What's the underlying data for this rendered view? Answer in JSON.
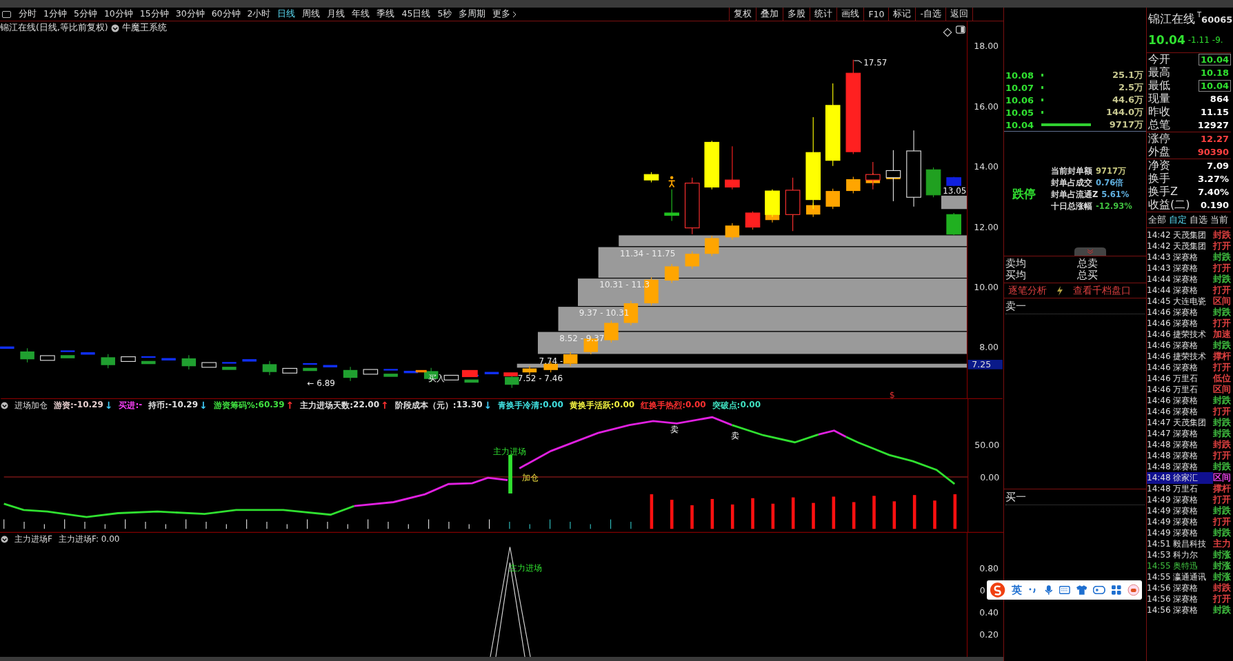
{
  "toolbar": {
    "periods": [
      {
        "label": "分时",
        "selected": false
      },
      {
        "label": "1分钟",
        "selected": false
      },
      {
        "label": "5分钟",
        "selected": false
      },
      {
        "label": "10分钟",
        "selected": false
      },
      {
        "label": "15分钟",
        "selected": false
      },
      {
        "label": "30分钟",
        "selected": false
      },
      {
        "label": "60分钟",
        "selected": false
      },
      {
        "label": "2小时",
        "selected": false
      },
      {
        "label": "日线",
        "selected": true
      },
      {
        "label": "周线",
        "selected": false
      },
      {
        "label": "月线",
        "selected": false
      },
      {
        "label": "年线",
        "selected": false
      },
      {
        "label": "季线",
        "selected": false
      },
      {
        "label": "45日线",
        "selected": false
      },
      {
        "label": "5秒",
        "selected": false
      },
      {
        "label": "多周期",
        "selected": false
      }
    ],
    "more": "更多",
    "buttons": [
      "复权",
      "叠加",
      "多股",
      "统计",
      "画线",
      "F10",
      "标记",
      "-自选",
      "返回"
    ]
  },
  "chart": {
    "title": "锦江在线(日线,等比前复权)",
    "system": "牛魔王系统",
    "price_axis": [
      "18.00",
      "16.00",
      "14.00",
      "12.00",
      "10.00",
      "8.00"
    ],
    "current_price_tag": "7.25",
    "high_label": "17.57",
    "last_label": "13.05",
    "low_label": "6.89",
    "low_arrow": "←",
    "buy_label": "买入",
    "zones": [
      "11.34 - 11.75",
      "10.31 - 11.3",
      "9.37 - 10.31",
      "8.52 - 9.37",
      "7.74 -",
      "7.52 - 7.46"
    ],
    "marker": "$"
  },
  "indicator_1": {
    "name": "进场加仓",
    "legend": [
      {
        "label": "游资:",
        "value": "-10.29",
        "arrow": {
          "text": "↓",
          "color": "#40d0ff"
        },
        "color": "#e8d0d0"
      },
      {
        "label": "买进:",
        "value": "-",
        "color": "#ff40ff"
      },
      {
        "label": "持币:",
        "value": "-10.29",
        "arrow": {
          "text": "↓",
          "color": "#40d0ff"
        },
        "color": "#e0e0e0"
      },
      {
        "label": "游资筹码%:",
        "value": "60.39",
        "arrow": {
          "text": "↑",
          "color": "#ff3030"
        },
        "color": "#40e040"
      },
      {
        "label": "主力进场天数:",
        "value": "22.00",
        "arrow": {
          "text": "↑",
          "color": "#ff3030"
        },
        "color": "#e0e0e0"
      },
      {
        "label": "阶段成本（元）:",
        "value": "13.30",
        "arrow": {
          "text": "↓",
          "color": "#40d0ff"
        },
        "color": "#e0e0e0"
      },
      {
        "label": "青换手冷清:",
        "value": "0.00",
        "color": "#40e0e0"
      },
      {
        "label": "黄换手活跃:",
        "value": "0.00",
        "color": "#f0f040"
      },
      {
        "label": "红换手热烈:",
        "value": "0.00",
        "color": "#ff3030"
      },
      {
        "label": "突破点:",
        "value": "0.00",
        "color": "#40e0c0"
      }
    ],
    "axis": [
      "50.00",
      "0.00"
    ],
    "labels": [
      {
        "text": "主力进场",
        "kind": "entry"
      },
      {
        "text": "加仓",
        "kind": "add"
      },
      {
        "text": "卖",
        "kind": "sell"
      },
      {
        "text": "卖",
        "kind": "sell"
      }
    ]
  },
  "indicator_2": {
    "name": "主力进场F",
    "legend": "主力进场F: 0.00",
    "axis": [
      "0.80",
      "0",
      "0.40",
      "0.20"
    ],
    "label": "主力进场"
  },
  "order_book": [
    {
      "price": "10.08",
      "volume": "25.1万",
      "kind": "dot"
    },
    {
      "price": "10.07",
      "volume": "2.5万",
      "kind": "dot"
    },
    {
      "price": "10.06",
      "volume": "44.6万",
      "kind": "dot"
    },
    {
      "price": "10.05",
      "volume": "144.0万",
      "kind": "dot"
    },
    {
      "price": "10.04",
      "volume": "9717万",
      "kind": "bar"
    }
  ],
  "limit_status": "跌停",
  "seal_info": [
    {
      "label": "当前封单额",
      "value": "9717万",
      "color": "#c8c880"
    },
    {
      "label": "封单占成交",
      "value": "0.76倍",
      "color": "#60b0e0"
    },
    {
      "label": "封单占流通Z",
      "value": "5.61%",
      "color": "#60b0e0"
    },
    {
      "label": "十日总涨幅",
      "value": "-12.93%",
      "color": "#40c040"
    }
  ],
  "totals": [
    {
      "left": "卖均",
      "right": "总卖"
    },
    {
      "left": "买均",
      "right": "总买"
    }
  ],
  "analysis_links": [
    "逐笔分析",
    "查看千档盘口"
  ],
  "sell_one": "卖一",
  "buy_one": "买一",
  "stock": {
    "name": "锦江在线",
    "mark": "T",
    "code": "60065",
    "price": "10.04",
    "change": "-1.11",
    "change_pct": "-9."
  },
  "quotes": [
    {
      "label": "今开",
      "value": "10.04",
      "color": "#30e030",
      "boxed": true
    },
    {
      "label": "最高",
      "value": "10.18",
      "color": "#30e030",
      "boxed": false
    },
    {
      "label": "最低",
      "value": "10.04",
      "color": "#30e030",
      "boxed": true
    },
    {
      "label": "现量",
      "value": "864",
      "color": "#ffffff",
      "boxed": false
    },
    {
      "label": "昨收",
      "value": "11.15",
      "color": "#ffffff",
      "boxed": false
    },
    {
      "label": "总笔",
      "value": "12927",
      "color": "#ffffff",
      "boxed": false
    },
    {
      "label": "涨停",
      "value": "12.27",
      "color": "#ff4040",
      "boxed": false
    },
    {
      "label": "外盘",
      "value": "90390",
      "color": "#ff4040",
      "boxed": false
    },
    {
      "label": "净资",
      "value": "7.09",
      "color": "#ffffff",
      "boxed": false
    },
    {
      "label": "换手",
      "value": "3.27%",
      "color": "#ffffff",
      "boxed": false
    },
    {
      "label": "换手Z",
      "value": "7.40%",
      "color": "#ffffff",
      "boxed": false
    },
    {
      "label": "收益(二)",
      "value": "0.190",
      "color": "#ffffff",
      "boxed": false
    }
  ],
  "list_tabs": [
    {
      "label": "全部",
      "selected": false
    },
    {
      "label": "自定",
      "selected": true
    },
    {
      "label": "自选",
      "selected": false
    },
    {
      "label": "当前",
      "selected": false
    }
  ],
  "alerts": [
    {
      "time": "14:42",
      "name": "天茂集团",
      "signal": "封跌",
      "color": "#e04040",
      "selected": false,
      "highlighted": false
    },
    {
      "time": "14:42",
      "name": "天茂集团",
      "signal": "打开",
      "color": "#e04040",
      "selected": false,
      "highlighted": false
    },
    {
      "time": "14:43",
      "name": "深赛格",
      "signal": "封跌",
      "color": "#40c040",
      "selected": false,
      "highlighted": false
    },
    {
      "time": "14:43",
      "name": "深赛格",
      "signal": "打开",
      "color": "#e04040",
      "selected": false,
      "highlighted": false
    },
    {
      "time": "14:44",
      "name": "深赛格",
      "signal": "封跌",
      "color": "#40c040",
      "selected": false,
      "highlighted": false
    },
    {
      "time": "14:44",
      "name": "深赛格",
      "signal": "打开",
      "color": "#e04040",
      "selected": false,
      "highlighted": false
    },
    {
      "time": "14:45",
      "name": "大连电瓷",
      "signal": "区间",
      "color": "#e04040",
      "selected": false,
      "highlighted": false
    },
    {
      "time": "14:46",
      "name": "深赛格",
      "signal": "封跌",
      "color": "#40c040",
      "selected": false,
      "highlighted": false
    },
    {
      "time": "14:46",
      "name": "深赛格",
      "signal": "打开",
      "color": "#e04040",
      "selected": false,
      "highlighted": false
    },
    {
      "time": "14:46",
      "name": "捷荣技术",
      "signal": "加速",
      "color": "#e04040",
      "selected": false,
      "highlighted": false
    },
    {
      "time": "14:46",
      "name": "深赛格",
      "signal": "封跌",
      "color": "#40c040",
      "selected": false,
      "highlighted": false
    },
    {
      "time": "14:46",
      "name": "捷荣技术",
      "signal": "撑杆",
      "color": "#e04040",
      "selected": false,
      "highlighted": false
    },
    {
      "time": "14:46",
      "name": "深赛格",
      "signal": "打开",
      "color": "#e04040",
      "selected": false,
      "highlighted": false
    },
    {
      "time": "14:46",
      "name": "万里石",
      "signal": "低位",
      "color": "#e04040",
      "selected": false,
      "highlighted": false
    },
    {
      "time": "14:46",
      "name": "万里石",
      "signal": "区间",
      "color": "#e04040",
      "selected": false,
      "highlighted": false
    },
    {
      "time": "14:46",
      "name": "深赛格",
      "signal": "封跌",
      "color": "#40c040",
      "selected": false,
      "highlighted": false
    },
    {
      "time": "14:46",
      "name": "深赛格",
      "signal": "打开",
      "color": "#e04040",
      "selected": false,
      "highlighted": false
    },
    {
      "time": "14:47",
      "name": "天茂集团",
      "signal": "封跌",
      "color": "#40c040",
      "selected": false,
      "highlighted": false
    },
    {
      "time": "14:47",
      "name": "深赛格",
      "signal": "封跌",
      "color": "#40c040",
      "selected": false,
      "highlighted": false
    },
    {
      "time": "14:48",
      "name": "深赛格",
      "signal": "封跌",
      "color": "#e04040",
      "selected": false,
      "highlighted": false
    },
    {
      "time": "14:48",
      "name": "深赛格",
      "signal": "打开",
      "color": "#e04040",
      "selected": false,
      "highlighted": false
    },
    {
      "time": "14:48",
      "name": "深赛格",
      "signal": "封跌",
      "color": "#40c040",
      "selected": false,
      "highlighted": false
    },
    {
      "time": "14:48",
      "name": "徐家汇",
      "signal": "区间",
      "color": "#e040e0",
      "selected": true,
      "highlighted": false
    },
    {
      "time": "14:48",
      "name": "万里石",
      "signal": "撑杆",
      "color": "#e04040",
      "selected": false,
      "highlighted": false
    },
    {
      "time": "14:49",
      "name": "深赛格",
      "signal": "打开",
      "color": "#e04040",
      "selected": false,
      "highlighted": false
    },
    {
      "time": "14:49",
      "name": "深赛格",
      "signal": "封跌",
      "color": "#40c040",
      "selected": false,
      "highlighted": false
    },
    {
      "time": "14:49",
      "name": "深赛格",
      "signal": "打开",
      "color": "#e04040",
      "selected": false,
      "highlighted": false
    },
    {
      "time": "14:49",
      "name": "深赛格",
      "signal": "封跌",
      "color": "#40c040",
      "selected": false,
      "highlighted": false
    },
    {
      "time": "14:51",
      "name": "毅昌科技",
      "signal": "主力",
      "color": "#e04040",
      "selected": false,
      "highlighted": false
    },
    {
      "time": "14:53",
      "name": "科力尔",
      "signal": "封涨",
      "color": "#40c040",
      "selected": false,
      "highlighted": false
    },
    {
      "time": "14:55",
      "name": "奥特迅",
      "signal": "封涨",
      "color": "#40c040",
      "selected": false,
      "highlighted": true
    },
    {
      "time": "14:55",
      "name": "瀛通通讯",
      "signal": "封涨",
      "color": "#40c040",
      "selected": false,
      "highlighted": false
    },
    {
      "time": "14:56",
      "name": "深赛格",
      "signal": "封跌",
      "color": "#e04040",
      "selected": false,
      "highlighted": false
    },
    {
      "time": "14:56",
      "name": "深赛格",
      "signal": "打开",
      "color": "#e04040",
      "selected": false,
      "highlighted": false
    },
    {
      "time": "14:56",
      "name": "深赛格",
      "signal": "封跌",
      "color": "#40c040",
      "selected": false,
      "highlighted": false
    }
  ],
  "ime_bar": {
    "mode": "英"
  }
}
